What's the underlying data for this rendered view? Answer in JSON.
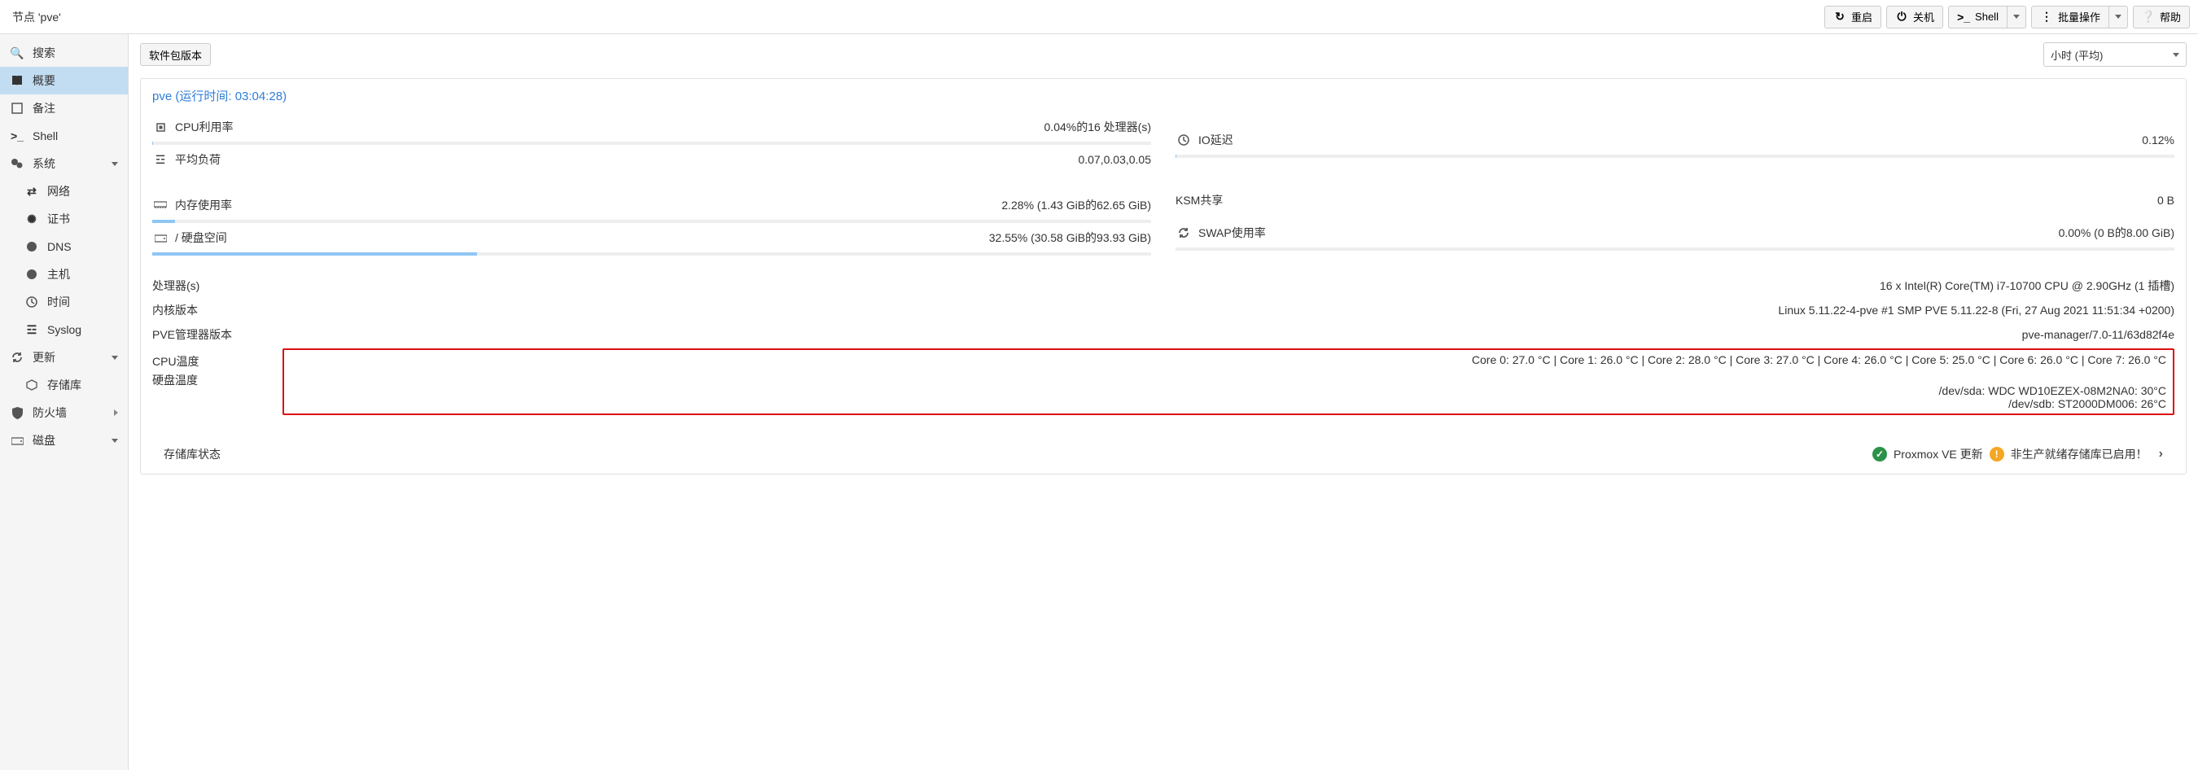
{
  "header": {
    "title": "节点 'pve'"
  },
  "toolbar": {
    "reboot": "重启",
    "shutdown": "关机",
    "shell": "Shell",
    "bulk": "批量操作",
    "help": "帮助"
  },
  "sidebar": {
    "search": "搜索",
    "summary": "概要",
    "notes": "备注",
    "shell": "Shell",
    "system": "系统",
    "network": "网络",
    "certs": "证书",
    "dns": "DNS",
    "hosts": "主机",
    "time": "时间",
    "syslog": "Syslog",
    "updates": "更新",
    "repos": "存储库",
    "firewall": "防火墙",
    "disks": "磁盘"
  },
  "content": {
    "pkg_btn": "软件包版本",
    "timerange": "小时 (平均)"
  },
  "panel": {
    "title_prefix": "pve (运行时间: ",
    "uptime": "03:04:28",
    "title_suffix": ")",
    "cpu_label": "CPU利用率",
    "cpu_value": "0.04%的16 处理器(s)",
    "cpu_pct": 0.04,
    "load_label": "平均负荷",
    "load_value": "0.07,0.03,0.05",
    "mem_label": "内存使用率",
    "mem_value": "2.28% (1.43 GiB的62.65 GiB)",
    "mem_pct": 2.28,
    "hd_label": "/ 硬盘空间",
    "hd_value": "32.55% (30.58 GiB的93.93 GiB)",
    "hd_pct": 32.55,
    "io_label": "IO延迟",
    "io_value": "0.12%",
    "io_pct": 0.12,
    "ksm_label": "KSM共享",
    "ksm_value": "0 B",
    "swap_label": "SWAP使用率",
    "swap_value": "0.00% (0 B的8.00 GiB)",
    "swap_pct": 0,
    "info_cpu_label": "处理器(s)",
    "info_cpu_value": "16 x Intel(R) Core(TM) i7-10700 CPU @ 2.90GHz (1 插槽)",
    "info_kernel_label": "内核版本",
    "info_kernel_value": "Linux 5.11.22-4-pve #1 SMP PVE 5.11.22-8 (Fri, 27 Aug 2021 11:51:34 +0200)",
    "info_pve_label": "PVE管理器版本",
    "info_pve_value": "pve-manager/7.0-11/63d82f4e",
    "info_cputemp_label": "CPU温度",
    "info_cputemp_value": "Core 0: 27.0 °C | Core 1: 26.0 °C | Core 2: 28.0 °C | Core 3: 27.0 °C | Core 4: 26.0 °C | Core 5: 25.0 °C | Core 6: 26.0 °C | Core 7: 26.0 °C",
    "info_hddtemp_label": "硬盘温度",
    "info_hddtemp_line1": "/dev/sda: WDC WD10EZEX-08M2NA0: 30°C",
    "info_hddtemp_line2": "/dev/sdb: ST2000DM006: 26°C",
    "repo_status_label": "存储库状态",
    "repo_ok": "Proxmox VE 更新",
    "repo_warn": "非生产就绪存储库已启用！"
  }
}
